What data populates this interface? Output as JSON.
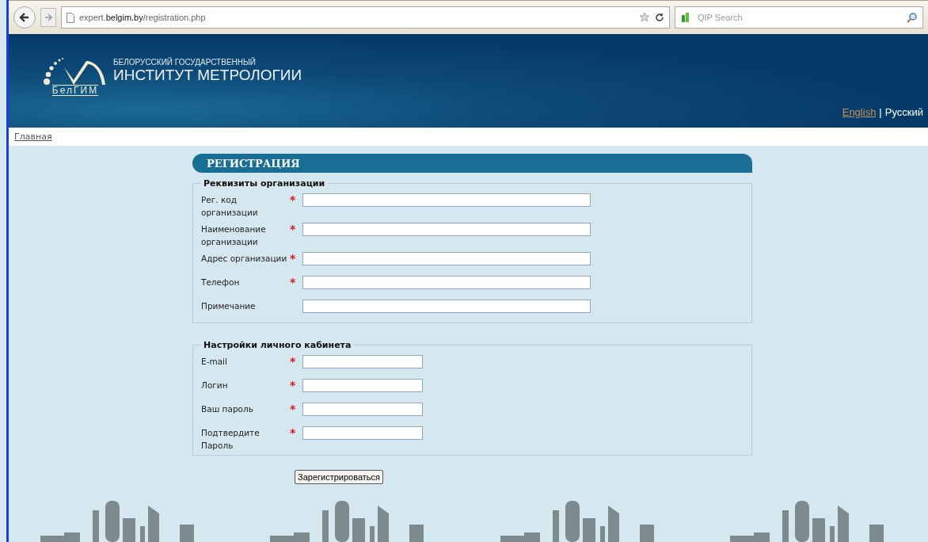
{
  "browser": {
    "url": "expert.**belgim.by**/registration.php",
    "search_placeholder": "QIP Search"
  },
  "header": {
    "logo_text": "БелГИМ",
    "subtitle": "БЕЛОРУССКИЙ ГОСУДАРСТВЕННЫЙ",
    "title": "ИНСТИТУТ МЕТРОЛОГИИ",
    "languages": [
      {
        "label": "English",
        "selected": false
      },
      {
        "label": "Русский",
        "selected": true
      }
    ],
    "separator": "|"
  },
  "nav": {
    "home": "Главная"
  },
  "form": {
    "title": "РЕГИСТРАЦИЯ",
    "sections": [
      {
        "legend": "Реквизиты организации",
        "fields": [
          {
            "label": "Рег. код организации",
            "required": true
          },
          {
            "label": "Наименование организации",
            "required": true
          },
          {
            "label": "Адрес организации",
            "required": true
          },
          {
            "label": "Телефон",
            "required": true
          },
          {
            "label": "Примечание",
            "required": false
          }
        ]
      },
      {
        "legend": "Настройки личного кабинета",
        "fields": [
          {
            "label": "E-mail",
            "required": true
          },
          {
            "label": "Логин",
            "required": true
          },
          {
            "label": "Ваш пароль",
            "required": true
          },
          {
            "label": "Подтвердите Пароль",
            "required": true
          }
        ]
      }
    ],
    "required_mark": "*",
    "submit": "Зарегистрироваться"
  }
}
